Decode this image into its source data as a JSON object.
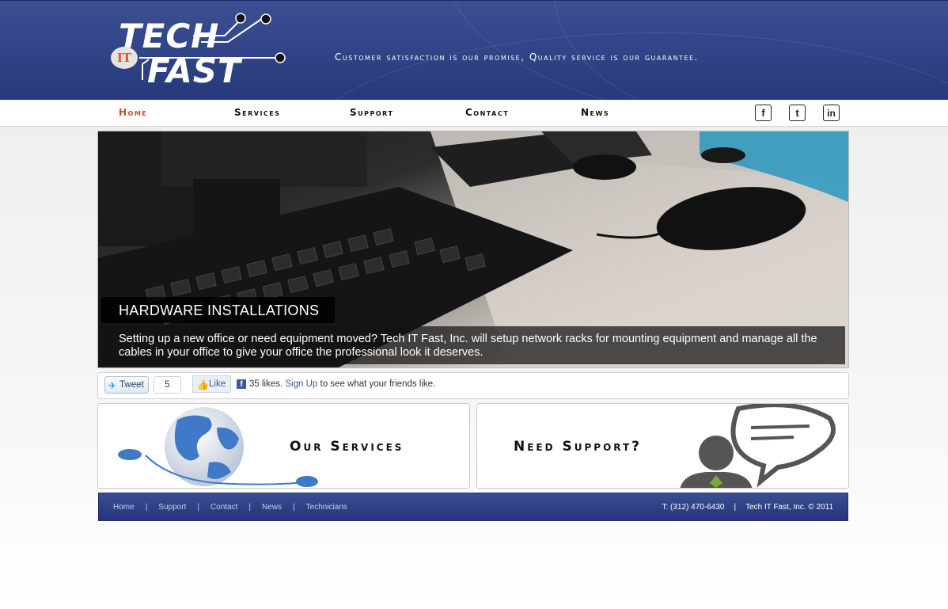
{
  "header": {
    "logo": {
      "tech": "TECH",
      "it": "IT",
      "fast": "FAST"
    },
    "tagline": "Customer satisfaction is our promise, Quality service is our guarantee."
  },
  "nav": {
    "items": [
      {
        "label": "Home",
        "active": true
      },
      {
        "label": "Services"
      },
      {
        "label": "Support"
      },
      {
        "label": "Contact"
      },
      {
        "label": "News"
      }
    ],
    "social": {
      "facebook": "f",
      "twitter": "t",
      "linkedin": "in"
    }
  },
  "slider": {
    "title": "HARDWARE INSTALLATIONS",
    "description": "Setting up a new office or need equipment moved? Tech IT Fast, Inc. will setup network racks for mounting equipment and manage all the cables in your office to give your office the professional look it deserves.",
    "controls": {
      "prev": "‹",
      "pause": "✲",
      "next": "›"
    }
  },
  "social_bar": {
    "tweet_label": "Tweet",
    "tweet_count": "5",
    "like_label": "Like",
    "likes_text": "35 likes.",
    "signup_link": "Sign Up",
    "signup_suffix": "to see what your friends like."
  },
  "boxes": {
    "services_title": "Our Services",
    "support_title": "Need Support?"
  },
  "footer": {
    "links": [
      "Home",
      "Support",
      "Contact",
      "News",
      "Technicians"
    ],
    "phone": "T: (312) 470-6430",
    "copyright": "Tech IT Fast, Inc. © 2011"
  },
  "colors": {
    "brand_blue": "#2f4386",
    "accent_orange": "#c9502a"
  }
}
